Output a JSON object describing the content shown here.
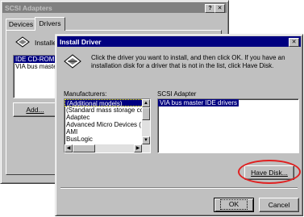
{
  "back_window": {
    "title": "SCSI Adapters",
    "help_btn": "?",
    "close_btn": "✕",
    "tabs": [
      "Devices",
      "Drivers"
    ],
    "installed_label": "Installe",
    "list": [
      "IDE CD-ROM (",
      "VIA bus maste"
    ],
    "add_button": "Add..."
  },
  "dialog": {
    "title": "Install Driver",
    "close_btn": "✕",
    "instruction": "Click the driver you want to install, and then click OK. If you have an installation disk for a driver that is not in the list, click Have Disk.",
    "manufacturers_label": "Manufacturers:",
    "manufacturers": [
      "(Additional models)",
      "(Standard mass storage co",
      "Adaptec",
      "Advanced Micro Devices (",
      "AMI",
      "BusLogic"
    ],
    "adapter_label": "SCSI Adapter",
    "adapters": [
      "VIA bus master IDE drivers"
    ],
    "have_disk_button": "Have Disk...",
    "ok_button": "OK",
    "cancel_button": "Cancel",
    "highlight_color": "#e02020"
  }
}
